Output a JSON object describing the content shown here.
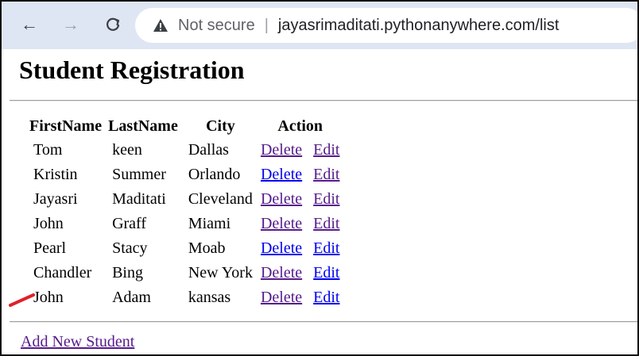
{
  "browser": {
    "security_text": "Not secure",
    "separator": "|",
    "url": "jayasrimaditati.pythonanywhere.com/list",
    "back_glyph": "←",
    "forward_glyph": "→",
    "reload_glyph": "C",
    "icons": {
      "back": "back-arrow-icon",
      "forward": "forward-arrow-icon",
      "reload": "reload-icon",
      "warning": "warning-triangle-icon"
    }
  },
  "page": {
    "title": "Student Registration",
    "table": {
      "headers": [
        "FirstName",
        "LastName",
        "City",
        "Action"
      ],
      "rows": [
        {
          "first": "Tom",
          "last": "keen",
          "city": "Dallas",
          "delete_label": "Delete",
          "edit_label": "Edit"
        },
        {
          "first": "Kristin",
          "last": "Summer",
          "city": "Orlando",
          "delete_label": "Delete",
          "edit_label": "Edit"
        },
        {
          "first": "Jayasri",
          "last": "Maditati",
          "city": "Cleveland",
          "delete_label": "Delete",
          "edit_label": "Edit"
        },
        {
          "first": "John",
          "last": "Graff",
          "city": "Miami",
          "delete_label": "Delete",
          "edit_label": "Edit"
        },
        {
          "first": "Pearl",
          "last": "Stacy",
          "city": "Moab",
          "delete_label": "Delete",
          "edit_label": "Edit"
        },
        {
          "first": "Chandler",
          "last": "Bing",
          "city": "New York",
          "delete_label": "Delete",
          "edit_label": "Edit"
        },
        {
          "first": "John",
          "last": "Adam",
          "city": "kansas",
          "delete_label": "Delete",
          "edit_label": "Edit"
        }
      ]
    },
    "add_link_label": "Add New Student"
  },
  "colors": {
    "toolbar_bg": "#dfe6f3",
    "visited_link": "#551a8b",
    "unvisited_link": "#0000ee",
    "annotation_mark": "#e0202a"
  }
}
